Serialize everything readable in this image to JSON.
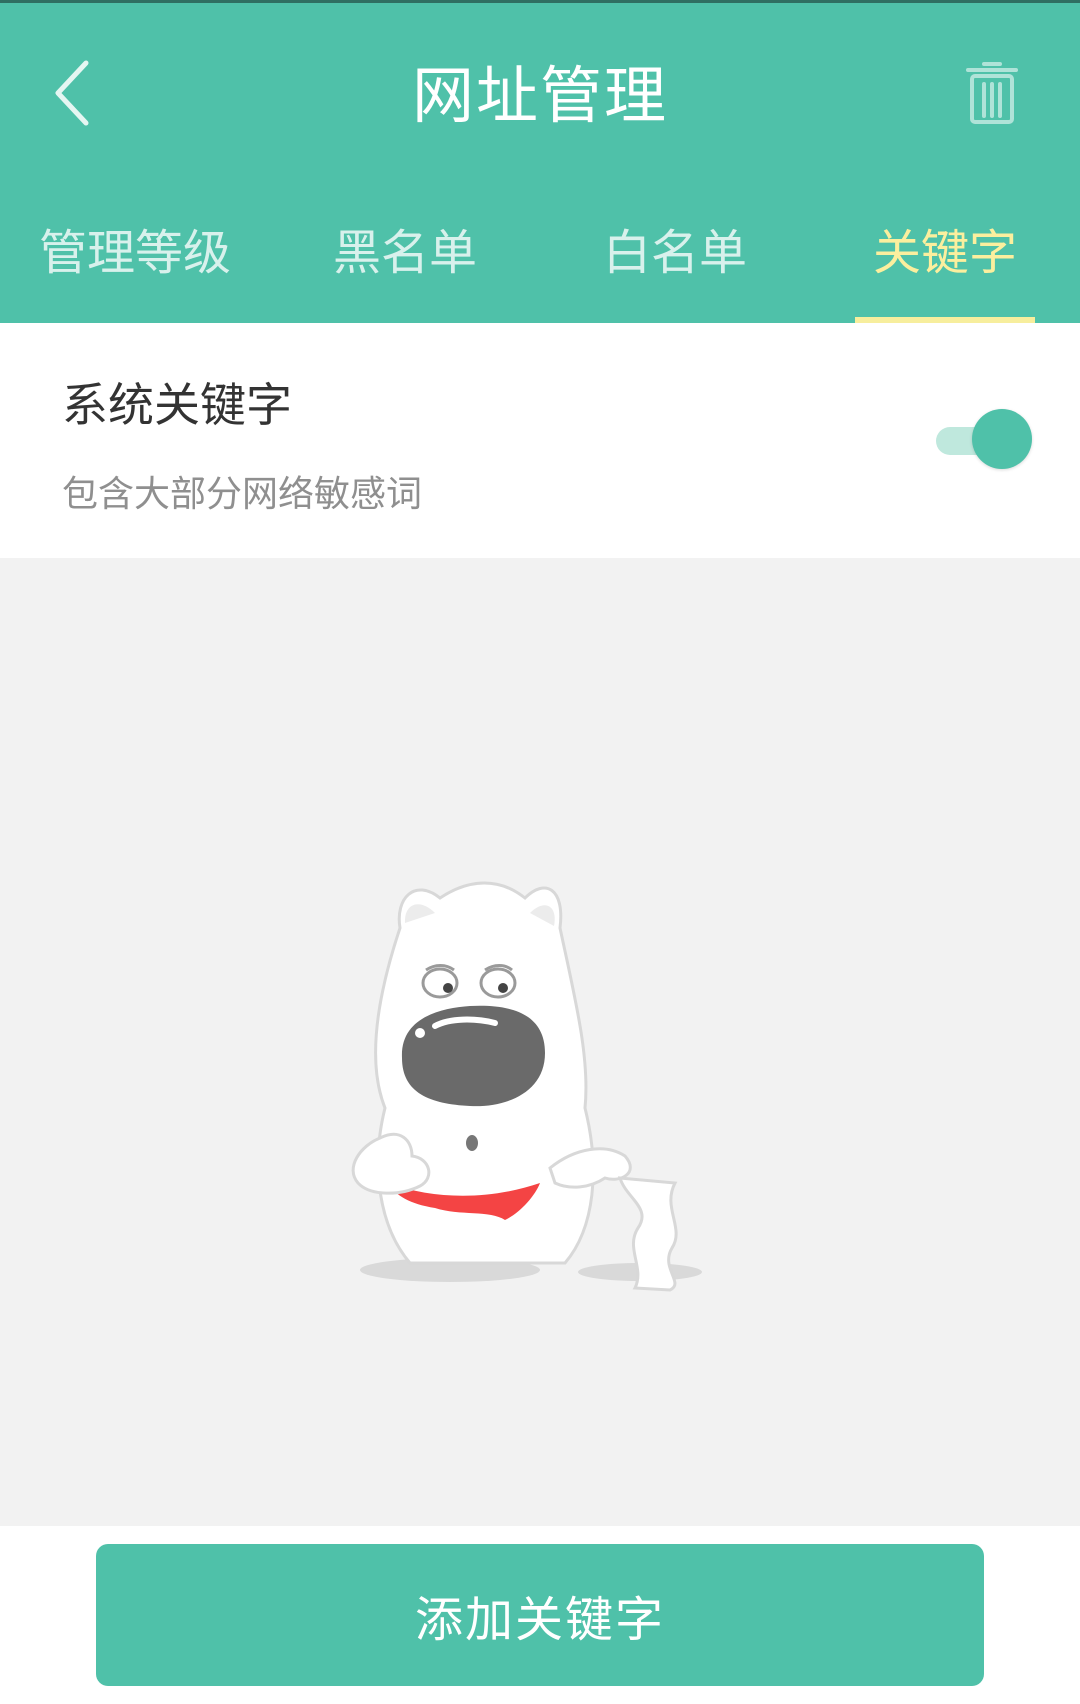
{
  "header": {
    "title": "网址管理"
  },
  "tabs": [
    {
      "label": "管理等级",
      "active": false
    },
    {
      "label": "黑名单",
      "active": false
    },
    {
      "label": "白名单",
      "active": false
    },
    {
      "label": "关键字",
      "active": true
    }
  ],
  "system_keyword": {
    "title": "系统关键字",
    "subtitle": "包含大部分网络敏感词",
    "enabled": true
  },
  "actions": {
    "add_label": "添加关键字"
  },
  "colors": {
    "primary": "#4fc1a9",
    "active_tab": "#fbef9e",
    "background": "#f2f2f2"
  },
  "icons": {
    "back": "chevron-left-icon",
    "delete": "trash-icon"
  }
}
